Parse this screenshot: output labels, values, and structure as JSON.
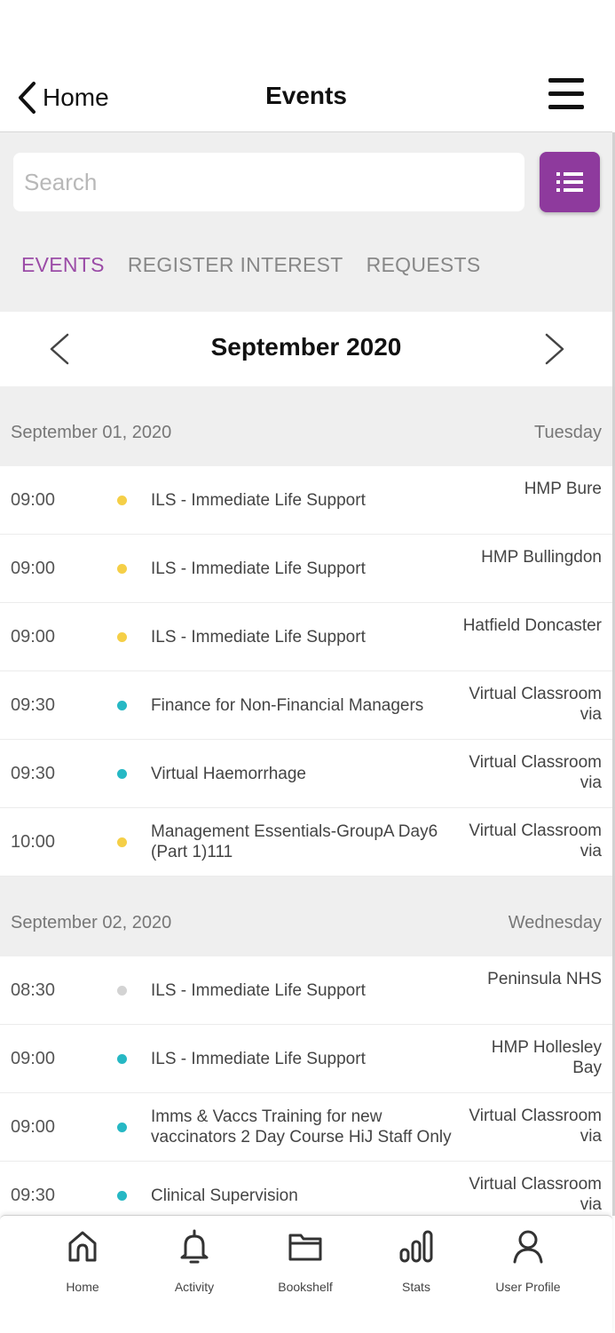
{
  "header": {
    "back_label": "Home",
    "title": "Events"
  },
  "search": {
    "placeholder": "Search"
  },
  "tabs": [
    {
      "label": "EVENTS",
      "active": true
    },
    {
      "label": "REGISTER INTEREST",
      "active": false
    },
    {
      "label": "REQUESTS",
      "active": false
    }
  ],
  "month": {
    "label": "September 2020"
  },
  "days": [
    {
      "date": "September 01, 2020",
      "weekday": "Tuesday",
      "events": [
        {
          "time": "09:00",
          "dot_color": "#f5cf47",
          "title": "ILS - Immediate Life Support",
          "venue": "HMP Bure"
        },
        {
          "time": "09:00",
          "dot_color": "#f5cf47",
          "title": "ILS - Immediate Life Support",
          "venue": "HMP Bullingdon"
        },
        {
          "time": "09:00",
          "dot_color": "#f5cf47",
          "title": "ILS - Immediate Life Support",
          "venue": "Hatfield Doncaster"
        },
        {
          "time": "09:30",
          "dot_color": "#26b8c4",
          "title": "Finance for Non-Financial Managers",
          "venue": "Virtual Classroom via"
        },
        {
          "time": "09:30",
          "dot_color": "#26b8c4",
          "title": "Virtual Haemorrhage",
          "venue": "Virtual Classroom via"
        },
        {
          "time": "10:00",
          "dot_color": "#f5cf47",
          "title": "Management Essentials-GroupA Day6 (Part 1)111",
          "venue": "Virtual Classroom via"
        }
      ]
    },
    {
      "date": "September 02, 2020",
      "weekday": "Wednesday",
      "events": [
        {
          "time": "08:30",
          "dot_color": "#d3d3d3",
          "title": "ILS - Immediate Life Support",
          "venue": "Peninsula NHS"
        },
        {
          "time": "09:00",
          "dot_color": "#26b8c4",
          "title": "ILS - Immediate Life Support",
          "venue": "HMP Hollesley Bay"
        },
        {
          "time": "09:00",
          "dot_color": "#26b8c4",
          "title": "Imms & Vaccs Training for new vaccinators 2 Day Course HiJ Staff Only",
          "venue": "Virtual Classroom via"
        },
        {
          "time": "09:30",
          "dot_color": "#26b8c4",
          "title": "Clinical Supervision",
          "venue": "Virtual Classroom via"
        }
      ]
    }
  ],
  "bottom_nav": [
    {
      "label": "Home",
      "icon": "home-icon"
    },
    {
      "label": "Activity",
      "icon": "bell-icon"
    },
    {
      "label": "Bookshelf",
      "icon": "folder-icon"
    },
    {
      "label": "Stats",
      "icon": "stats-icon"
    },
    {
      "label": "User Profile",
      "icon": "user-icon"
    }
  ],
  "colors": {
    "accent": "#8e3a9d",
    "active_tab": "#9b4ca7",
    "dot_yellow": "#f5cf47",
    "dot_teal": "#26b8c4",
    "dot_gray": "#d3d3d3"
  }
}
